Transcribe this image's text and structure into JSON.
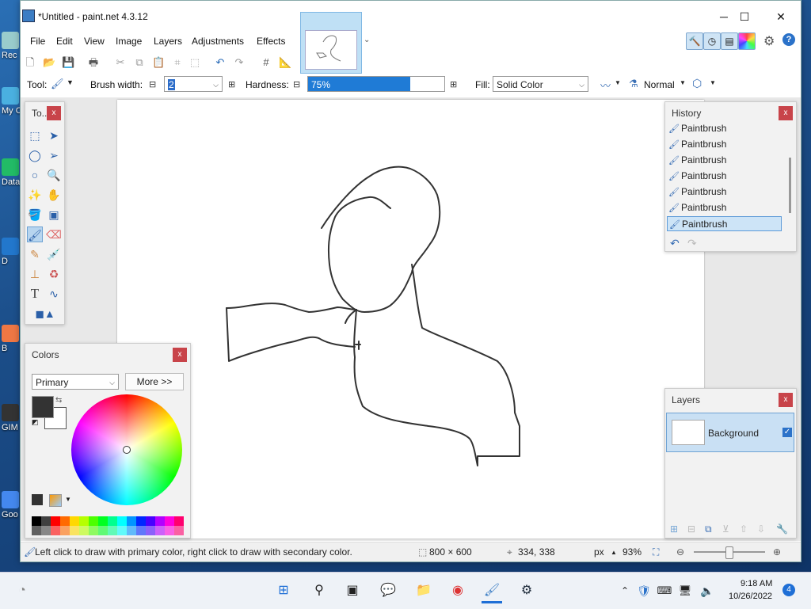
{
  "window": {
    "title": "*Untitled - paint.net 4.3.12",
    "minimize": "─",
    "maximize": "☐",
    "close": "✕"
  },
  "menu": [
    "File",
    "Edit",
    "View",
    "Image",
    "Layers",
    "Adjustments",
    "Effects"
  ],
  "desktop_icons": [
    "Rec",
    "My C",
    "Data",
    "D",
    "B",
    "GIM",
    "Goo"
  ],
  "toolbar": {
    "tool_label": "Tool:",
    "brush_width_label": "Brush width:",
    "brush_width_value": "2",
    "hardness_label": "Hardness:",
    "hardness_value": "75%",
    "hardness_fraction": 0.75,
    "fill_label": "Fill:",
    "fill_value": "Solid Color",
    "blend_mode": "Normal"
  },
  "tools_panel": {
    "title": "To...",
    "close": "x"
  },
  "colors_panel": {
    "title": "Colors",
    "close": "x",
    "mode_select": "Primary",
    "more_button": "More >>",
    "primary_color": "#333333",
    "secondary_color": "#ffffff",
    "palette": [
      "#000000",
      "#404040",
      "#ff0000",
      "#ff6a00",
      "#ffd800",
      "#b6ff00",
      "#4cff00",
      "#00ff21",
      "#00ff90",
      "#00ffff",
      "#0094ff",
      "#0026ff",
      "#4800ff",
      "#b200ff",
      "#ff00dc",
      "#ff006e"
    ]
  },
  "history_panel": {
    "title": "History",
    "close": "x",
    "items": [
      "Paintbrush",
      "Paintbrush",
      "Paintbrush",
      "Paintbrush",
      "Paintbrush",
      "Paintbrush",
      "Paintbrush"
    ],
    "selected_index": 6
  },
  "layers_panel": {
    "title": "Layers",
    "close": "x",
    "layers": [
      {
        "name": "Background",
        "visible": true
      }
    ]
  },
  "status": {
    "hint": "Left click to draw with primary color, right click to draw with secondary color.",
    "image_size": "800 × 600",
    "cursor_pos": "334, 338",
    "units": "px",
    "zoom": "93%"
  },
  "taskbar": {
    "time": "9:18 AM",
    "date": "10/26/2022",
    "notification_count": "4"
  }
}
